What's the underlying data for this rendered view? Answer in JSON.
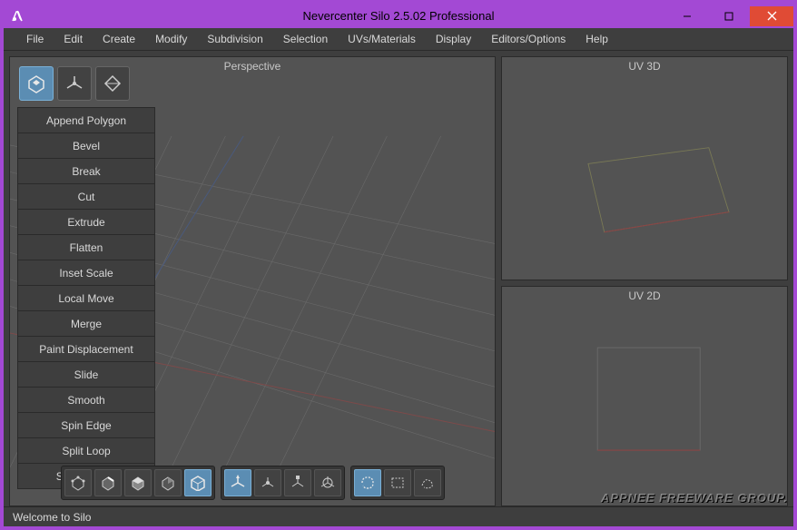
{
  "app": {
    "title": "Nevercenter Silo 2.5.02 Professional"
  },
  "menu": {
    "items": [
      "File",
      "Edit",
      "Create",
      "Modify",
      "Subdivision",
      "Selection",
      "UVs/Materials",
      "Display",
      "Editors/Options",
      "Help"
    ]
  },
  "viewports": {
    "main": "Perspective",
    "top_right": "UV 3D",
    "bottom_right": "UV 2D"
  },
  "tool_icons": [
    {
      "name": "shape-tool-icon",
      "active": true
    },
    {
      "name": "axis-tool-icon",
      "active": false
    },
    {
      "name": "diamond-tool-icon",
      "active": false
    }
  ],
  "tool_list": [
    "Append Polygon",
    "Bevel",
    "Break",
    "Cut",
    "Extrude",
    "Flatten",
    "Inset Scale",
    "Local Move",
    "Merge",
    "Paint Displacement",
    "Slide",
    "Smooth",
    "Spin Edge",
    "Split Loop",
    "Surface Tool"
  ],
  "bottom_toolbar": [
    {
      "group": "mode",
      "buttons": [
        {
          "name": "vertex-mode-icon",
          "active": false
        },
        {
          "name": "edge-mode-icon",
          "active": false
        },
        {
          "name": "face-mode-icon",
          "active": false
        },
        {
          "name": "object-mode-icon",
          "active": false
        },
        {
          "name": "cube-mode-icon",
          "active": true
        }
      ]
    },
    {
      "group": "manip",
      "buttons": [
        {
          "name": "move-tool-icon",
          "active": true
        },
        {
          "name": "rotate-tool-icon",
          "active": false
        },
        {
          "name": "scale-tool-icon",
          "active": false
        },
        {
          "name": "universal-tool-icon",
          "active": false
        }
      ]
    },
    {
      "group": "select",
      "buttons": [
        {
          "name": "lasso-select-icon",
          "active": true
        },
        {
          "name": "rect-select-icon",
          "active": false
        },
        {
          "name": "paint-select-icon",
          "active": false
        }
      ]
    }
  ],
  "status": {
    "text": "Welcome to Silo"
  },
  "watermark": "APPNEE FREEWARE GROUP."
}
